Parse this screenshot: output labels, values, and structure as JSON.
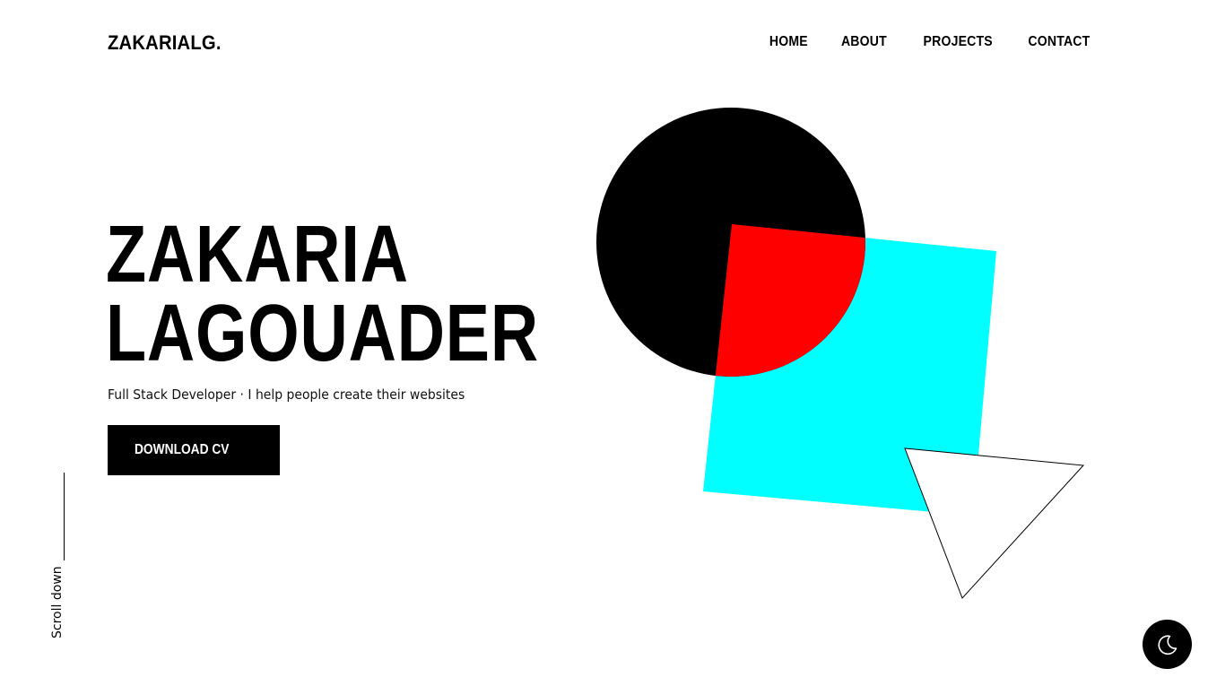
{
  "header": {
    "logo": "ZAKARIALG.",
    "nav": [
      {
        "label": "HOME"
      },
      {
        "label": "ABOUT"
      },
      {
        "label": "PROJECTS"
      },
      {
        "label": "CONTACT"
      }
    ]
  },
  "hero": {
    "name_line1": "ZAKARIA",
    "name_line2": "LAGOUADER",
    "subtitle": "Full Stack Developer · I help people create their websites",
    "cta_label": "DOWNLOAD CV"
  },
  "scroll": {
    "label": "Scroll down"
  },
  "shapes": {
    "circle_color": "#000000",
    "square_color": "#00ffff",
    "overlap_color": "#ff0000",
    "triangle_fill": "#ffffff",
    "triangle_stroke": "#000000"
  },
  "theme_toggle": {
    "icon": "moon-icon",
    "background": "#000000"
  }
}
